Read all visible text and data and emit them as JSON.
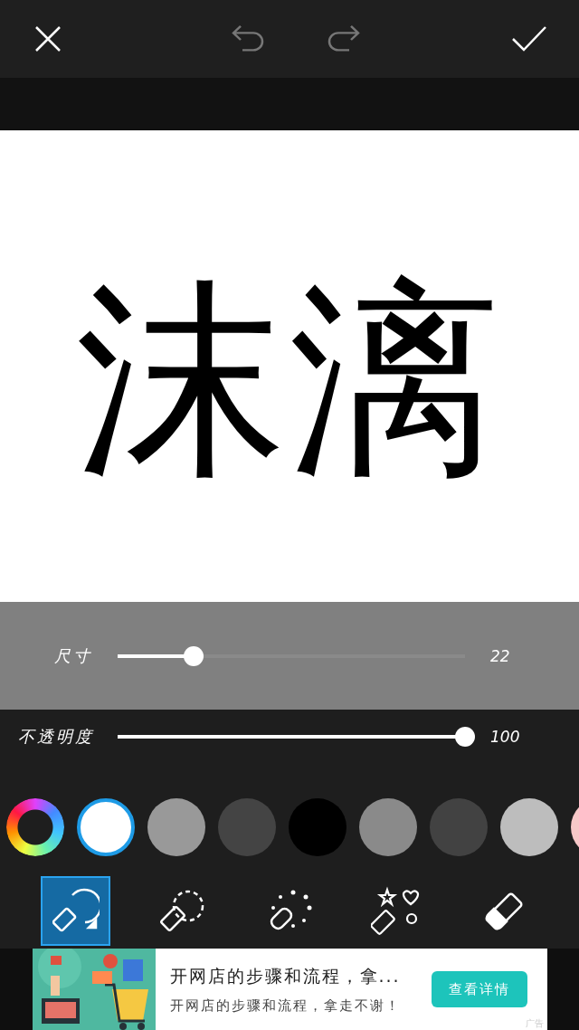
{
  "canvas_text": "沫漓",
  "sliders": [
    {
      "label": "尺寸",
      "level": 0.22,
      "reading": "22",
      "kind": "light"
    },
    {
      "label": "不透明度",
      "level": 1,
      "reading": "100",
      "kind": "dark"
    }
  ],
  "swatches": [
    {
      "kind": "wheel",
      "selected": false
    },
    {
      "kind": "color",
      "color": "#ffffff",
      "selected": true
    },
    {
      "kind": "color",
      "color": "#999999",
      "selected": false
    },
    {
      "kind": "color",
      "color": "#444444",
      "selected": false
    },
    {
      "kind": "color",
      "color": "#000000",
      "selected": false
    },
    {
      "kind": "color",
      "color": "#8a8a8a",
      "selected": false
    },
    {
      "kind": "color",
      "color": "#424242",
      "selected": false
    },
    {
      "kind": "color",
      "color": "#bdbdbd",
      "selected": false
    },
    {
      "kind": "color",
      "color": "#f7c8c8",
      "selected": false
    }
  ],
  "tools": [
    {
      "kind": "brush",
      "selected": true
    },
    {
      "kind": "dashed",
      "selected": false
    },
    {
      "kind": "dots",
      "selected": false
    },
    {
      "kind": "shapes",
      "selected": false
    },
    {
      "kind": "eraser",
      "selected": false
    }
  ],
  "ad": {
    "title": "开网店的步骤和流程，拿...",
    "subtitle": "开网店的步骤和流程，拿走不谢！",
    "button": "查看详情",
    "label": "广告"
  }
}
